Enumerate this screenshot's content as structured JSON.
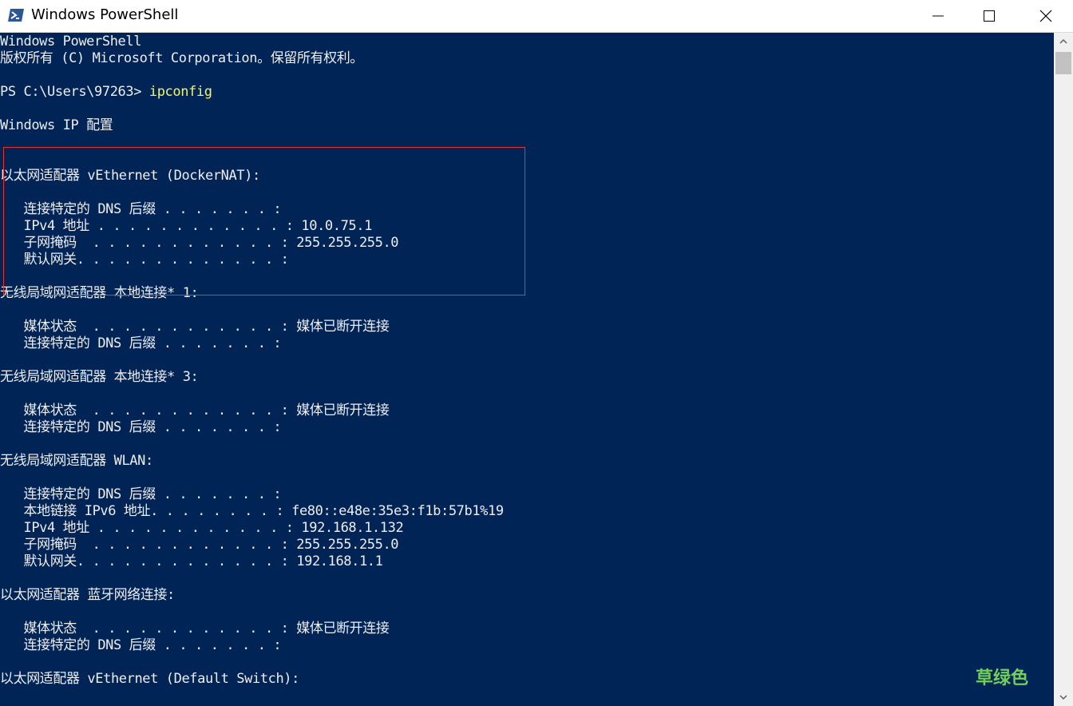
{
  "window": {
    "title": "Windows PowerShell",
    "icon": "powershell-icon",
    "buttons": {
      "minimize": "minimize-icon",
      "maximize": "maximize-icon",
      "close": "close-icon"
    }
  },
  "console": {
    "background": "#012456",
    "text_color": "#eeedf0",
    "command_color": "#f3f46f",
    "lines": [
      "Windows PowerShell",
      "版权所有 (C) Microsoft Corporation。保留所有权利。",
      "",
      "PS C:\\Users\\97263> ",
      "",
      "Windows IP 配置",
      "",
      "",
      "以太网适配器 vEthernet (DockerNAT):",
      "",
      "   连接特定的 DNS 后缀 . . . . . . . :",
      "   IPv4 地址 . . . . . . . . . . . . : 10.0.75.1",
      "   子网掩码  . . . . . . . . . . . . : 255.255.255.0",
      "   默认网关. . . . . . . . . . . . . :",
      "",
      "无线局域网适配器 本地连接* 1:",
      "",
      "   媒体状态  . . . . . . . . . . . . : 媒体已断开连接",
      "   连接特定的 DNS 后缀 . . . . . . . :",
      "",
      "无线局域网适配器 本地连接* 3:",
      "",
      "   媒体状态  . . . . . . . . . . . . : 媒体已断开连接",
      "   连接特定的 DNS 后缀 . . . . . . . :",
      "",
      "无线局域网适配器 WLAN:",
      "",
      "   连接特定的 DNS 后缀 . . . . . . . :",
      "   本地链接 IPv6 地址. . . . . . . . : fe80::e48e:35e3:f1b:57b1%19",
      "   IPv4 地址 . . . . . . . . . . . . : 192.168.1.132",
      "   子网掩码  . . . . . . . . . . . . : 255.255.255.0",
      "   默认网关. . . . . . . . . . . . . : 192.168.1.1",
      "",
      "以太网适配器 蓝牙网络连接:",
      "",
      "   媒体状态  . . . . . . . . . . . . : 媒体已断开连接",
      "   连接特定的 DNS 后缀 . . . . . . . :",
      "",
      "以太网适配器 vEthernet (Default Switch):"
    ],
    "command": "ipconfig"
  },
  "annotation": {
    "box_color": "#e8332c"
  },
  "watermark": {
    "text": "草绿色",
    "color": "#6fd15a"
  },
  "scrollbar": {
    "up": "scroll-up-arrow-icon",
    "down": "scroll-down-arrow-icon"
  }
}
